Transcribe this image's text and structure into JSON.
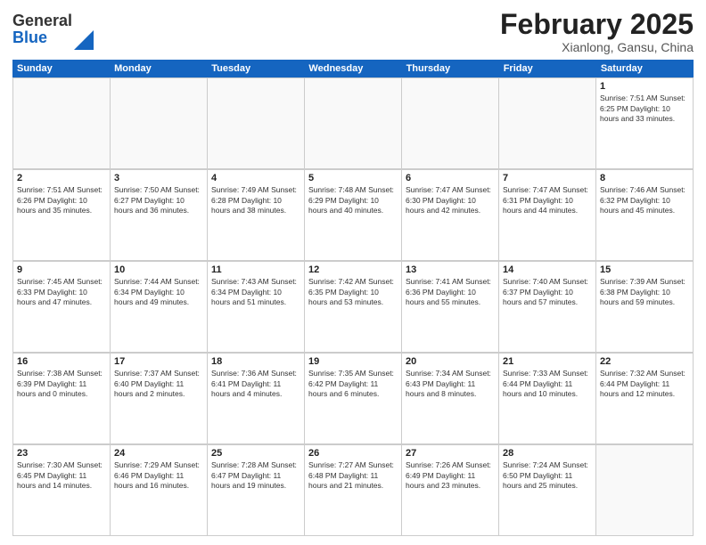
{
  "header": {
    "logo_general": "General",
    "logo_blue": "Blue",
    "month_title": "February 2025",
    "location": "Xianlong, Gansu, China"
  },
  "weekdays": [
    "Sunday",
    "Monday",
    "Tuesday",
    "Wednesday",
    "Thursday",
    "Friday",
    "Saturday"
  ],
  "weeks": [
    [
      {
        "day": "",
        "info": ""
      },
      {
        "day": "",
        "info": ""
      },
      {
        "day": "",
        "info": ""
      },
      {
        "day": "",
        "info": ""
      },
      {
        "day": "",
        "info": ""
      },
      {
        "day": "",
        "info": ""
      },
      {
        "day": "1",
        "info": "Sunrise: 7:51 AM\nSunset: 6:25 PM\nDaylight: 10 hours and 33 minutes."
      }
    ],
    [
      {
        "day": "2",
        "info": "Sunrise: 7:51 AM\nSunset: 6:26 PM\nDaylight: 10 hours and 35 minutes."
      },
      {
        "day": "3",
        "info": "Sunrise: 7:50 AM\nSunset: 6:27 PM\nDaylight: 10 hours and 36 minutes."
      },
      {
        "day": "4",
        "info": "Sunrise: 7:49 AM\nSunset: 6:28 PM\nDaylight: 10 hours and 38 minutes."
      },
      {
        "day": "5",
        "info": "Sunrise: 7:48 AM\nSunset: 6:29 PM\nDaylight: 10 hours and 40 minutes."
      },
      {
        "day": "6",
        "info": "Sunrise: 7:47 AM\nSunset: 6:30 PM\nDaylight: 10 hours and 42 minutes."
      },
      {
        "day": "7",
        "info": "Sunrise: 7:47 AM\nSunset: 6:31 PM\nDaylight: 10 hours and 44 minutes."
      },
      {
        "day": "8",
        "info": "Sunrise: 7:46 AM\nSunset: 6:32 PM\nDaylight: 10 hours and 45 minutes."
      }
    ],
    [
      {
        "day": "9",
        "info": "Sunrise: 7:45 AM\nSunset: 6:33 PM\nDaylight: 10 hours and 47 minutes."
      },
      {
        "day": "10",
        "info": "Sunrise: 7:44 AM\nSunset: 6:34 PM\nDaylight: 10 hours and 49 minutes."
      },
      {
        "day": "11",
        "info": "Sunrise: 7:43 AM\nSunset: 6:34 PM\nDaylight: 10 hours and 51 minutes."
      },
      {
        "day": "12",
        "info": "Sunrise: 7:42 AM\nSunset: 6:35 PM\nDaylight: 10 hours and 53 minutes."
      },
      {
        "day": "13",
        "info": "Sunrise: 7:41 AM\nSunset: 6:36 PM\nDaylight: 10 hours and 55 minutes."
      },
      {
        "day": "14",
        "info": "Sunrise: 7:40 AM\nSunset: 6:37 PM\nDaylight: 10 hours and 57 minutes."
      },
      {
        "day": "15",
        "info": "Sunrise: 7:39 AM\nSunset: 6:38 PM\nDaylight: 10 hours and 59 minutes."
      }
    ],
    [
      {
        "day": "16",
        "info": "Sunrise: 7:38 AM\nSunset: 6:39 PM\nDaylight: 11 hours and 0 minutes."
      },
      {
        "day": "17",
        "info": "Sunrise: 7:37 AM\nSunset: 6:40 PM\nDaylight: 11 hours and 2 minutes."
      },
      {
        "day": "18",
        "info": "Sunrise: 7:36 AM\nSunset: 6:41 PM\nDaylight: 11 hours and 4 minutes."
      },
      {
        "day": "19",
        "info": "Sunrise: 7:35 AM\nSunset: 6:42 PM\nDaylight: 11 hours and 6 minutes."
      },
      {
        "day": "20",
        "info": "Sunrise: 7:34 AM\nSunset: 6:43 PM\nDaylight: 11 hours and 8 minutes."
      },
      {
        "day": "21",
        "info": "Sunrise: 7:33 AM\nSunset: 6:44 PM\nDaylight: 11 hours and 10 minutes."
      },
      {
        "day": "22",
        "info": "Sunrise: 7:32 AM\nSunset: 6:44 PM\nDaylight: 11 hours and 12 minutes."
      }
    ],
    [
      {
        "day": "23",
        "info": "Sunrise: 7:30 AM\nSunset: 6:45 PM\nDaylight: 11 hours and 14 minutes."
      },
      {
        "day": "24",
        "info": "Sunrise: 7:29 AM\nSunset: 6:46 PM\nDaylight: 11 hours and 16 minutes."
      },
      {
        "day": "25",
        "info": "Sunrise: 7:28 AM\nSunset: 6:47 PM\nDaylight: 11 hours and 19 minutes."
      },
      {
        "day": "26",
        "info": "Sunrise: 7:27 AM\nSunset: 6:48 PM\nDaylight: 11 hours and 21 minutes."
      },
      {
        "day": "27",
        "info": "Sunrise: 7:26 AM\nSunset: 6:49 PM\nDaylight: 11 hours and 23 minutes."
      },
      {
        "day": "28",
        "info": "Sunrise: 7:24 AM\nSunset: 6:50 PM\nDaylight: 11 hours and 25 minutes."
      },
      {
        "day": "",
        "info": ""
      }
    ]
  ]
}
